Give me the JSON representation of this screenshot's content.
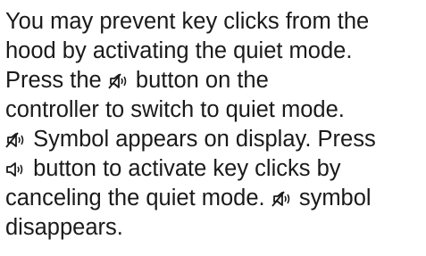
{
  "document": {
    "lines": {
      "l1": "You may prevent key clicks from the",
      "l2": "hood by activating the quiet mode.",
      "l3a": "Press the",
      "l3b": "button on the",
      "l4": "controller to switch to quiet mode.",
      "l5": "Symbol appears on display. Press",
      "l6": "button to activate key clicks by",
      "l7a": "canceling the quiet mode.",
      "l7b": "symbol",
      "l8": "disappears."
    },
    "icons": {
      "mute": "speaker-muted-icon",
      "sound": "speaker-sound-icon"
    },
    "text_color": "#1a1a1a"
  }
}
